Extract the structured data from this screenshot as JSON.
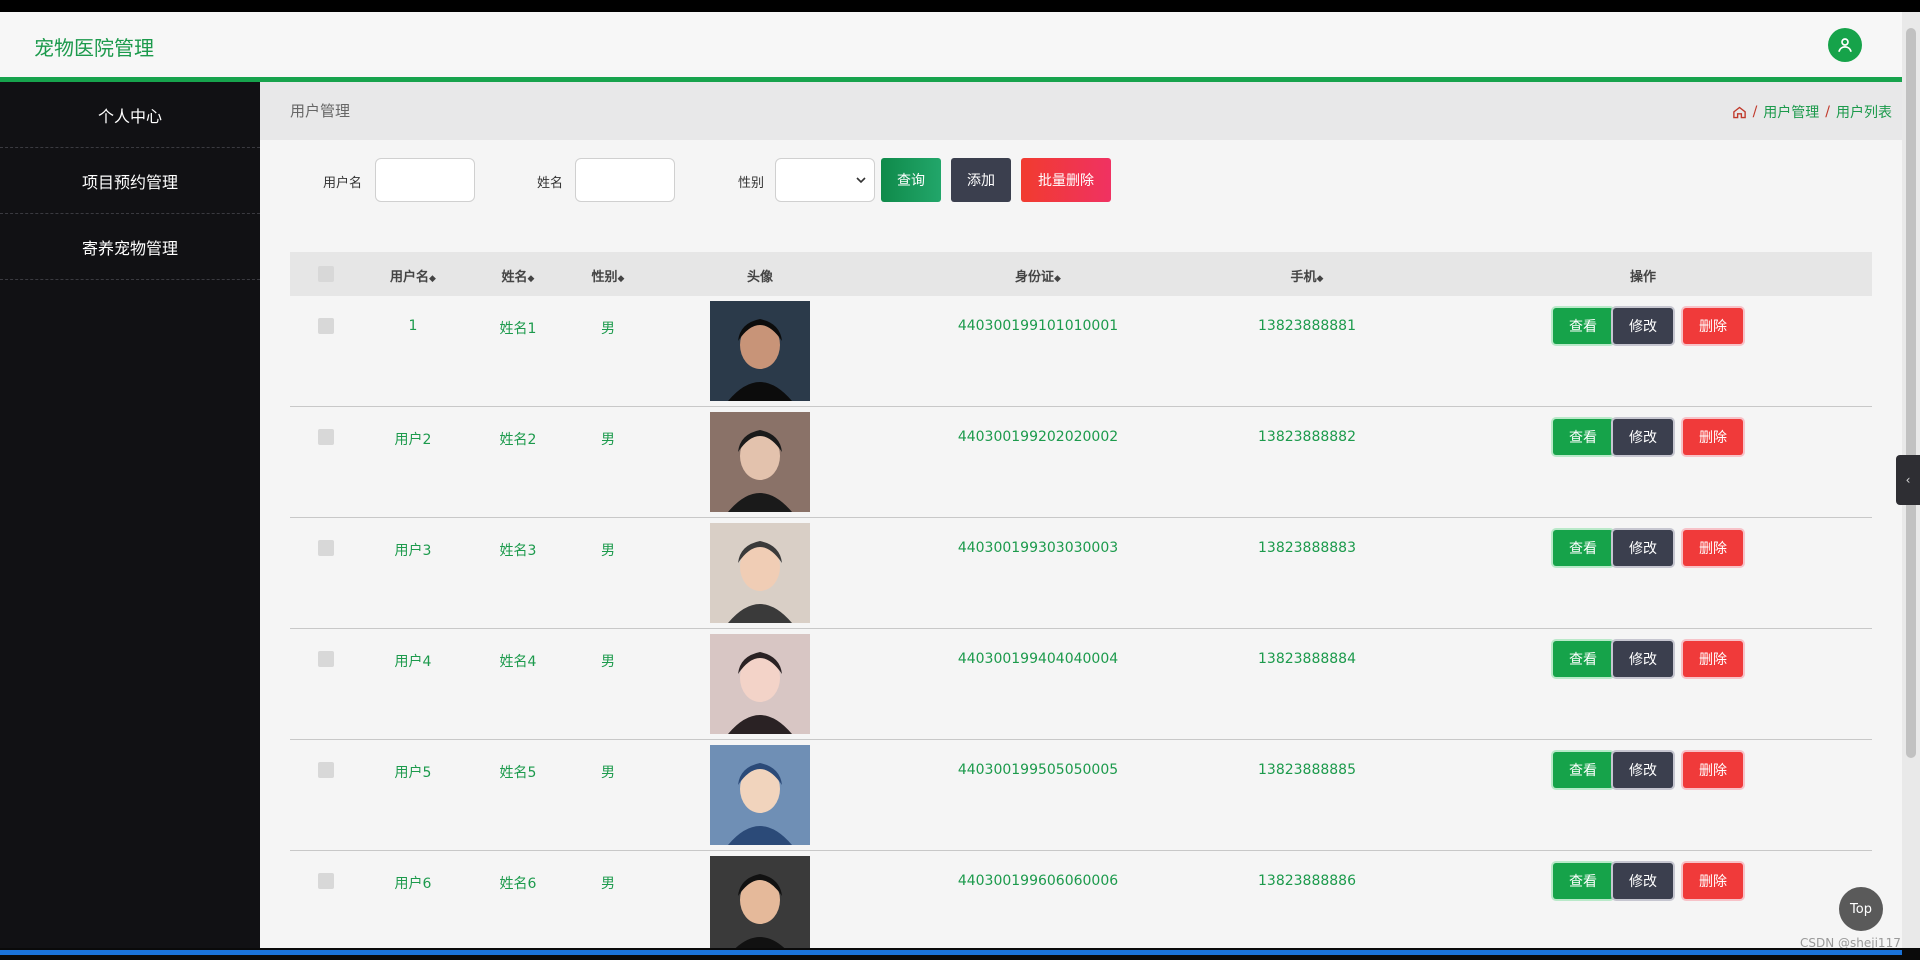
{
  "header": {
    "brand": "宠物医院管理"
  },
  "sidebar": {
    "items": [
      {
        "label": "个人中心"
      },
      {
        "label": "项目预约管理"
      },
      {
        "label": "寄养宠物管理"
      }
    ]
  },
  "breadcrumb": {
    "title": "用户管理",
    "links": [
      "用户管理",
      "用户列表"
    ],
    "sep": "/"
  },
  "filters": {
    "username_label": "用户名",
    "name_label": "姓名",
    "gender_label": "性别",
    "query_label": "查询",
    "add_label": "添加",
    "batch_delete_label": "批量删除"
  },
  "table": {
    "headers": {
      "username": "用户名",
      "name": "姓名",
      "gender": "性别",
      "avatar": "头像",
      "idcard": "身份证",
      "phone": "手机",
      "actions": "操作"
    },
    "actions": {
      "view": "查看",
      "edit": "修改",
      "delete": "删除"
    },
    "rows": [
      {
        "username": "1",
        "name": "姓名1",
        "gender": "男",
        "idcard": "440300199101010001",
        "phone": "13823888881"
      },
      {
        "username": "用户2",
        "name": "姓名2",
        "gender": "男",
        "idcard": "440300199202020002",
        "phone": "13823888882"
      },
      {
        "username": "用户3",
        "name": "姓名3",
        "gender": "男",
        "idcard": "440300199303030003",
        "phone": "13823888883"
      },
      {
        "username": "用户4",
        "name": "姓名4",
        "gender": "男",
        "idcard": "440300199404040004",
        "phone": "13823888884"
      },
      {
        "username": "用户5",
        "name": "姓名5",
        "gender": "男",
        "idcard": "440300199505050005",
        "phone": "13823888885"
      },
      {
        "username": "用户6",
        "name": "姓名6",
        "gender": "男",
        "idcard": "440300199606060006",
        "phone": "13823888886"
      }
    ]
  },
  "misc": {
    "top_label": "Top",
    "watermark": "CSDN @sheji117"
  },
  "colors": {
    "accent": "#1c9a4c",
    "sidebar": "#111114",
    "danger": "#f03a3a",
    "dark_btn": "#3b3f4e"
  }
}
